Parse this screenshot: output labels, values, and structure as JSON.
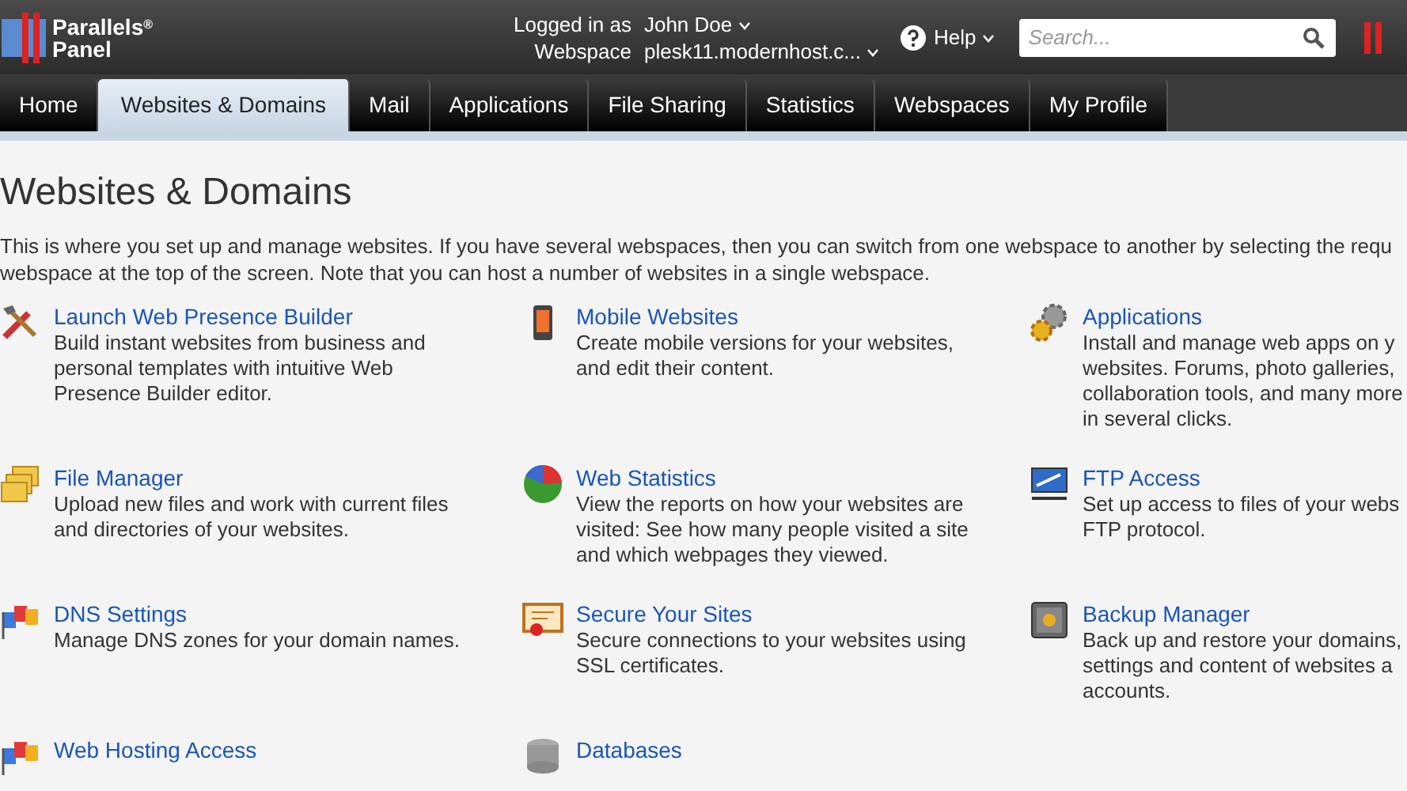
{
  "header": {
    "brand_line_1": "Parallels",
    "brand_mark": "®",
    "brand_line_2": "Panel",
    "logged_in_label": "Logged in as",
    "user": "John Doe",
    "webspace_label": "Webspace",
    "webspace": "plesk11.modernhost.c...",
    "help": "Help",
    "search": {
      "placeholder": "Search..."
    }
  },
  "tabs": [
    {
      "label": "Home",
      "selected": false
    },
    {
      "label": "Websites & Domains",
      "selected": true
    },
    {
      "label": "Mail",
      "selected": false
    },
    {
      "label": "Applications",
      "selected": false
    },
    {
      "label": "File Sharing",
      "selected": false
    },
    {
      "label": "Statistics",
      "selected": false
    },
    {
      "label": "Webspaces",
      "selected": false
    },
    {
      "label": "My Profile",
      "selected": false
    }
  ],
  "page": {
    "title": "Websites & Domains",
    "intro": [
      "This is where you set up and manage websites. If you have several webspaces, then you can switch from one webspace to another by selecting the requ",
      "webspace at the top of the screen. Note that you can host a number of websites in a single webspace."
    ]
  },
  "items": [
    {
      "kind": "tools",
      "title": "Launch Web Presence Builder",
      "lines": [
        "Build instant websites from business and",
        "personal templates with intuitive Web",
        "Presence Builder editor."
      ]
    },
    {
      "kind": "phone",
      "title": "Mobile Websites",
      "lines": [
        "Create mobile versions for your websites,",
        "and edit their content."
      ]
    },
    {
      "kind": "gears",
      "title": "Applications",
      "lines": [
        "Install and manage web apps on y",
        "websites. Forums, photo galleries,",
        "collaboration tools, and many more",
        "in several clicks."
      ]
    },
    {
      "kind": "folders",
      "title": "File Manager",
      "lines": [
        "Upload new files and work with current files",
        "and directories of your websites."
      ]
    },
    {
      "kind": "pie",
      "title": "Web Statistics",
      "lines": [
        "View the reports on how your websites are",
        "visited: See how many people visited a site",
        "and which webpages they viewed."
      ]
    },
    {
      "kind": "ftp",
      "title": "FTP Access",
      "lines": [
        "Set up access to files of your webs",
        "FTP protocol."
      ]
    },
    {
      "kind": "flags",
      "title": "DNS Settings",
      "lines": [
        "Manage DNS zones for your domain names."
      ]
    },
    {
      "kind": "certificate",
      "title": "Secure Your Sites",
      "lines": [
        "Secure connections to your websites using",
        "SSL certificates."
      ]
    },
    {
      "kind": "safe",
      "title": "Backup Manager",
      "lines": [
        "Back up and restore your domains,",
        "settings and content of websites a",
        "accounts."
      ]
    },
    {
      "kind": "flags",
      "title": "Web Hosting Access"
    },
    {
      "kind": "database",
      "title": "Databases"
    }
  ]
}
